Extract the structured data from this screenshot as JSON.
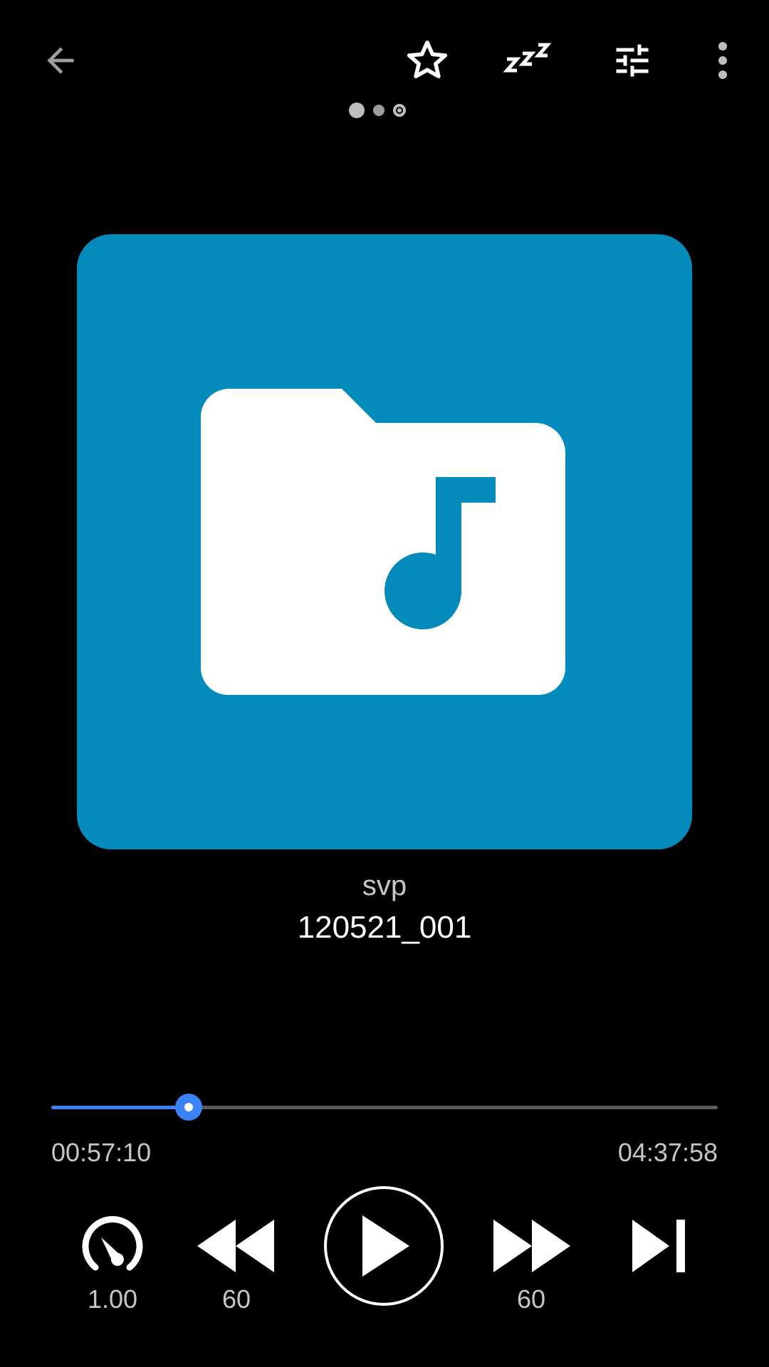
{
  "icons": {
    "back": "arrow-left-icon",
    "favorite": "star-outline-icon",
    "sleep_timer": "zzz-icon",
    "equalizer": "sliders-icon",
    "more": "more-vertical-icon",
    "album_art": "folder-music-icon",
    "speed": "speedometer-icon",
    "rewind": "rewind-icon",
    "play": "play-icon",
    "forward": "fast-forward-icon",
    "next": "skip-next-icon"
  },
  "pager": {
    "pages": 3,
    "current": 3
  },
  "track": {
    "folder": "svp",
    "name": "120521_001"
  },
  "progress": {
    "current_time": "00:57:10",
    "total_time": "04:37:58",
    "fraction": 0.206
  },
  "controls": {
    "speed_label": "1.00",
    "rewind_label": "60",
    "forward_label": "60"
  },
  "colors": {
    "background": "#000000",
    "art_background": "#028bbb",
    "accent": "#3b82f6",
    "track_inactive": "#5b5b5b",
    "secondary_text": "#c6c6c6"
  }
}
